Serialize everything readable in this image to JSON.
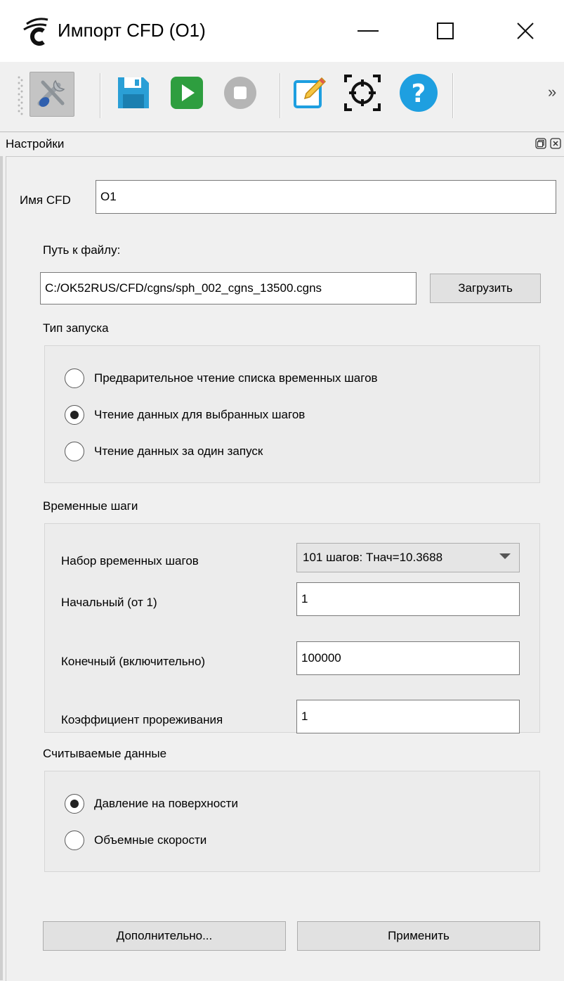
{
  "window": {
    "title": "Импорт CFD (O1)",
    "min_glyph": "—",
    "max_glyph": "☐",
    "close_glyph": "✕"
  },
  "toolbar": {
    "icons": [
      "settings-tools-icon",
      "save-icon",
      "run-icon",
      "stop-icon",
      "edit-icon",
      "focus-target-icon",
      "help-icon"
    ],
    "more_glyph": "»",
    "colors": {
      "save": "#2a9fd6",
      "run": "#2e9e3f",
      "stop": "#b5b5b5",
      "edit": "#1e9fe0",
      "help": "#1e9fe0"
    }
  },
  "dock": {
    "title": "Настройки"
  },
  "form": {
    "cfd_name_label": "Имя CFD",
    "cfd_name_value": "O1",
    "path_label": "Путь к файлу:",
    "path_value": "C:/OK52RUS/CFD/cgns/sph_002_cgns_13500.cgns",
    "load_button": "Загрузить"
  },
  "launch_type": {
    "title": "Тип запуска",
    "options": [
      {
        "label": "Предварительное чтение списка временных шагов",
        "selected": false
      },
      {
        "label": "Чтение данных для выбранных шагов",
        "selected": true
      },
      {
        "label": "Чтение данных за один запуск",
        "selected": false
      }
    ]
  },
  "time_steps": {
    "title": "Временные шаги",
    "set_label": "Набор временных шагов",
    "set_value": "101 шагов: Тнач=10.3688",
    "start_label": "Начальный (от 1)",
    "start_value": "1",
    "end_label": "Конечный (включительно)",
    "end_value": "100000",
    "thin_label": "Коэффициент прореживания",
    "thin_value": "1"
  },
  "read_data": {
    "title": "Считываемые данные",
    "options": [
      {
        "label": "Давление на поверхности",
        "selected": true
      },
      {
        "label": "Объемные скорости",
        "selected": false
      }
    ]
  },
  "footer": {
    "advanced_button": "Дополнительно...",
    "apply_button": "Применить"
  }
}
